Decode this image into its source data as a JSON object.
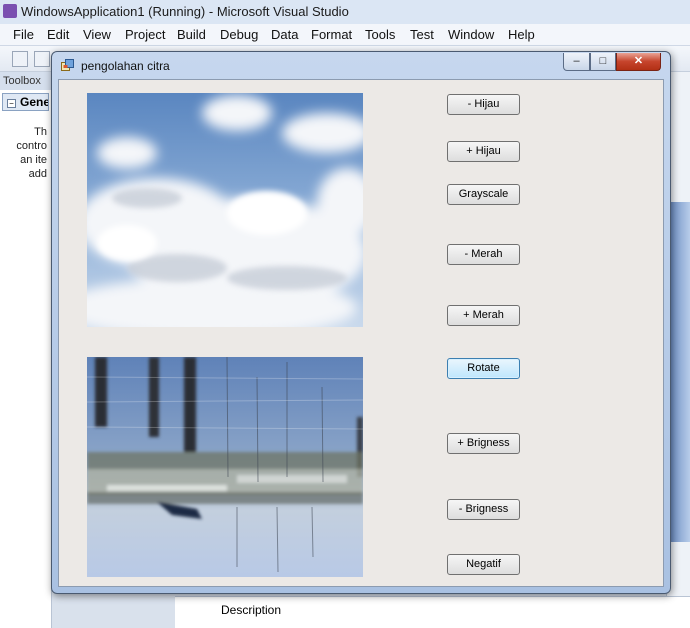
{
  "ide": {
    "title": "WindowsApplication1 (Running) - Microsoft Visual Studio",
    "menu": [
      "File",
      "Edit",
      "View",
      "Project",
      "Build",
      "Debug",
      "Data",
      "Format",
      "Tools",
      "Test",
      "Window",
      "Help"
    ],
    "toolbox": {
      "header": "Toolbox",
      "group": "General",
      "info": [
        "Th",
        "contro",
        "an ite",
        "add"
      ]
    },
    "properties": {
      "description_label": "Description"
    }
  },
  "form": {
    "title": "pengolahan citra",
    "caption_buttons": {
      "minimize": "–",
      "maximize": "□",
      "close": "✕"
    },
    "buttons": [
      "- Hijau",
      "+ Hijau",
      "Grayscale",
      "- Merah",
      "+ Merah",
      "Rotate",
      "+ Brigness",
      "- Brigness",
      "Negatif"
    ],
    "focused_button": "Rotate",
    "images": [
      "clouds-sky-photo",
      "harbor-reflection-photo-rotated"
    ]
  },
  "colors": {
    "form_bg": "#ece9e6",
    "title_gradient_top": "#c6d7ee",
    "close_red": "#c6442c"
  }
}
